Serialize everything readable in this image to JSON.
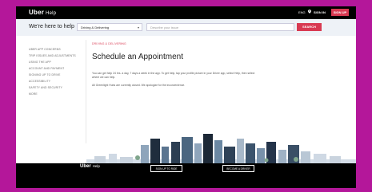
{
  "header": {
    "brand": "Uber",
    "brand_sub": "Help",
    "language": "ENG",
    "location_icon": "pin-icon",
    "sign_in": "SIGN IN",
    "sign_up": "SIGN UP"
  },
  "help_bar": {
    "title": "We're here to help",
    "category_selected": "Driving & Delivering",
    "search_placeholder": "Describe your issue",
    "search_button": "SEARCH"
  },
  "sidebar": {
    "items": [
      {
        "label": "UBER APP CONCERNS"
      },
      {
        "label": "TRIP ISSUES AND ADJUSTMENTS"
      },
      {
        "label": "USING THE APP"
      },
      {
        "label": "ACCOUNT AND PAYMENT"
      },
      {
        "label": "SIGNING UP TO DRIVE"
      },
      {
        "label": "ACCESSIBILITY"
      },
      {
        "label": "SAFETY AND SECURITY"
      },
      {
        "label": "MORE"
      }
    ]
  },
  "main": {
    "breadcrumb": "DRIVING & DELIVERING",
    "breadcrumb_sep": "›",
    "title": "Schedule an Appointment",
    "paragraph1": "You can get help 24 hrs. a day, 7 days a week in the app. To get help, tap your profile picture in your Driver app, select Help, then select where we can help.",
    "paragraph2": "All Greenlight Hubs are currently closed. We apologize for the inconvenience."
  },
  "footer": {
    "brand": "Uber",
    "brand_sub": "Help",
    "sign_up_button": "SIGN UP TO RIDE",
    "driver_button": "BECOME A DRIVER"
  },
  "colors": {
    "accent": "#d83a52",
    "background": "#b4179a",
    "header_bg": "#000000",
    "help_bar_bg": "#eef2f7"
  }
}
